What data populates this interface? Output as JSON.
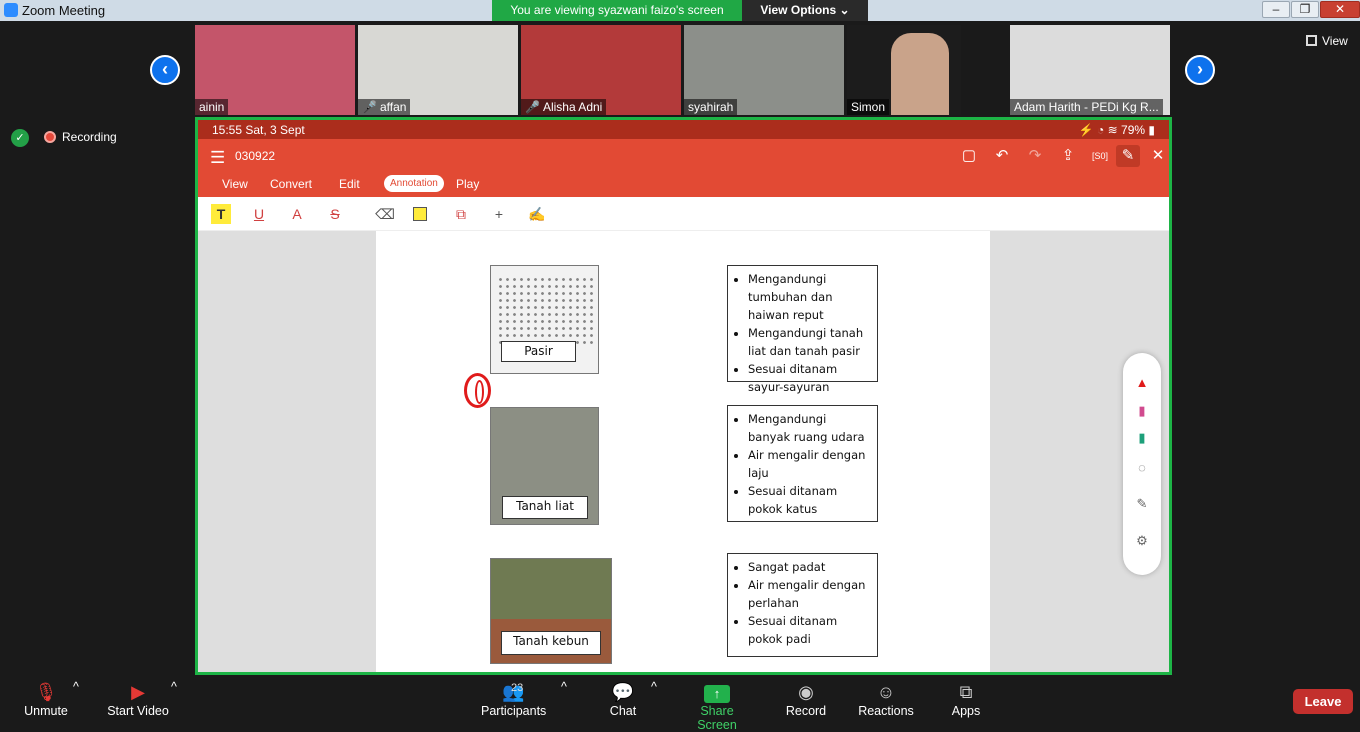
{
  "window": {
    "title": "Zoom Meeting"
  },
  "banner": {
    "sharing": "You are viewing syazwani faizo's screen",
    "view_options": "View Options"
  },
  "gallery": {
    "participants": [
      {
        "name": "ainin",
        "muted": false,
        "color": "#c4556a"
      },
      {
        "name": "affan",
        "muted": true,
        "color": "#d8d8d4"
      },
      {
        "name": "Alisha Adni",
        "muted": true,
        "color": "#b33a3a"
      },
      {
        "name": "syahirah",
        "muted": false,
        "color": "#8c8f8a"
      },
      {
        "name": "Simon",
        "muted": false,
        "color": "#1c1c1c"
      },
      {
        "name": "Adam Harith - PEDi Kg R...",
        "muted": false,
        "color": "#dcdcdc"
      }
    ]
  },
  "view_label": "View",
  "recording_label": "Recording",
  "device": {
    "time": "15:55  Sat, 3 Sept",
    "battery": "79%"
  },
  "app": {
    "filename": "030922",
    "tabs": [
      "View",
      "Convert",
      "Edit",
      "Annotation",
      "Play"
    ],
    "active_tab": "Annotation"
  },
  "worksheet": {
    "pictures": [
      {
        "caption": "Pasir",
        "color": "#f2f2f2"
      },
      {
        "caption": "Tanah liat",
        "color": "#8c8f84"
      },
      {
        "caption": "Tanah kebun",
        "color": "#6f7a52"
      }
    ],
    "descriptions": [
      [
        "Mengandungi tumbuhan dan haiwan reput",
        "Mengandungi tanah liat dan tanah pasir",
        "Sesuai ditanam sayur-sayuran"
      ],
      [
        "Mengandungi banyak ruang udara",
        "Air mengalir dengan laju",
        "Sesuai ditanam pokok katus"
      ],
      [
        "Sangat padat",
        "Air mengalir dengan perlahan",
        "Sesuai ditanam pokok padi"
      ]
    ]
  },
  "toolbar": {
    "unmute": "Unmute",
    "start_video": "Start Video",
    "participants": "Participants",
    "participant_count": "23",
    "chat": "Chat",
    "share_screen": "Share Screen",
    "record": "Record",
    "reactions": "Reactions",
    "apps": "Apps",
    "leave": "Leave"
  }
}
